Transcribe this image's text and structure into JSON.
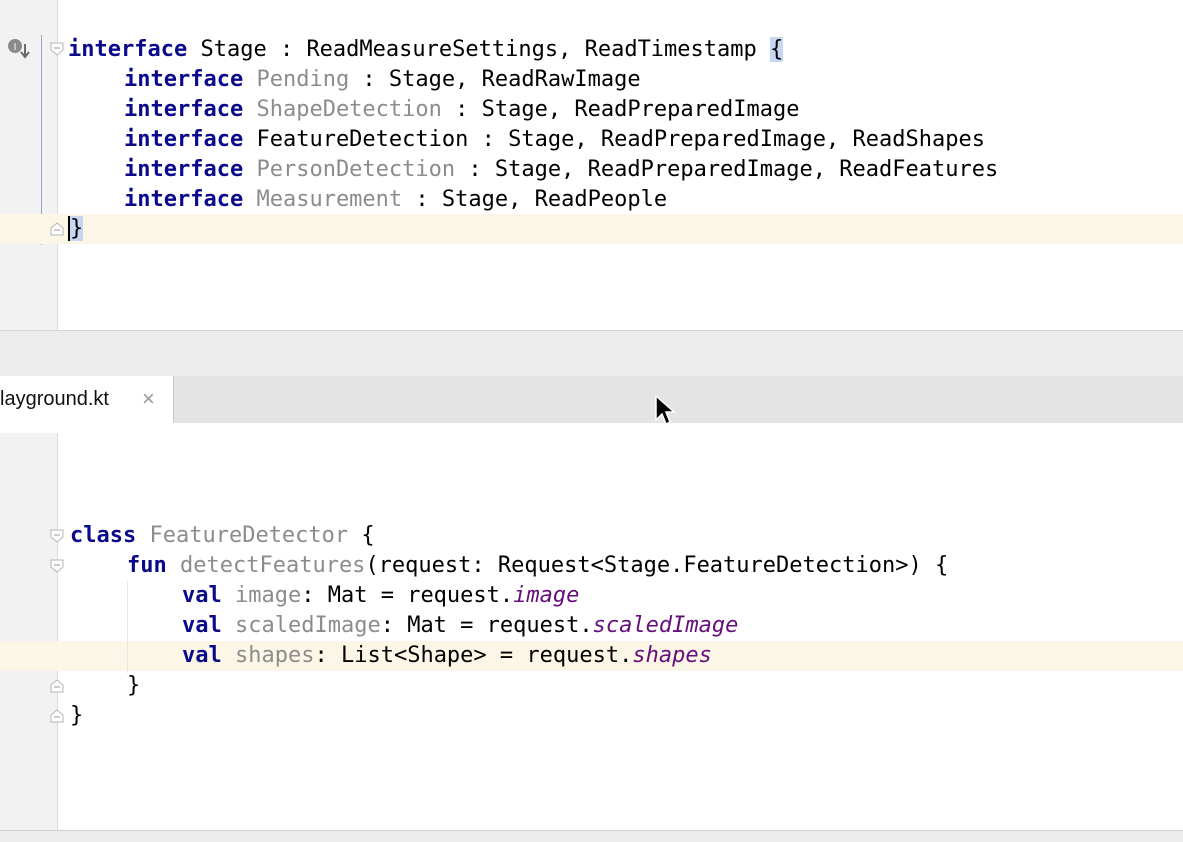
{
  "top_editor": {
    "lines": [
      {
        "kw": "interface",
        "name": "Stage",
        "rest": " : ReadMeasureSettings, ReadTimestamp ",
        "brace": "{"
      },
      {
        "kw": "interface",
        "name": "Pending",
        "rest": " : Stage, ReadRawImage"
      },
      {
        "kw": "interface",
        "name": "ShapeDetection",
        "rest": " : Stage, ReadPreparedImage"
      },
      {
        "kw": "interface",
        "name": "FeatureDetection",
        "rest": " : Stage, ReadPreparedImage, ReadShapes"
      },
      {
        "kw": "interface",
        "name": "PersonDetection",
        "rest": " : Stage, ReadPreparedImage, ReadFeatures"
      },
      {
        "kw": "interface",
        "name": "Measurement",
        "rest": " : Stage, ReadPeople"
      },
      {
        "close": "}"
      }
    ]
  },
  "tab": {
    "label": "layground.kt",
    "close": "×"
  },
  "bottom_editor": {
    "lines": [
      {
        "kw": "class",
        "name": "FeatureDetector",
        "rest": " {"
      },
      {
        "kw": "fun",
        "name": "detectFeatures",
        "rest": "(request: Request<Stage.FeatureDetection>) {"
      },
      {
        "kw": "val",
        "name": "image",
        "rest": ": Mat = request.",
        "prop": "image"
      },
      {
        "kw": "val",
        "name": "scaledImage",
        "rest": ": Mat = request.",
        "prop": "scaledImage"
      },
      {
        "kw": "val",
        "name": "shapes",
        "rest": ": List<Shape> = request.",
        "prop": "shapes"
      },
      {
        "close": "}"
      },
      {
        "close": "}"
      }
    ]
  },
  "icons": {
    "gutter_implemented": "implemented-gutter-icon",
    "fold": "fold-marker-icon",
    "cursor": "mouse-pointer-icon"
  }
}
